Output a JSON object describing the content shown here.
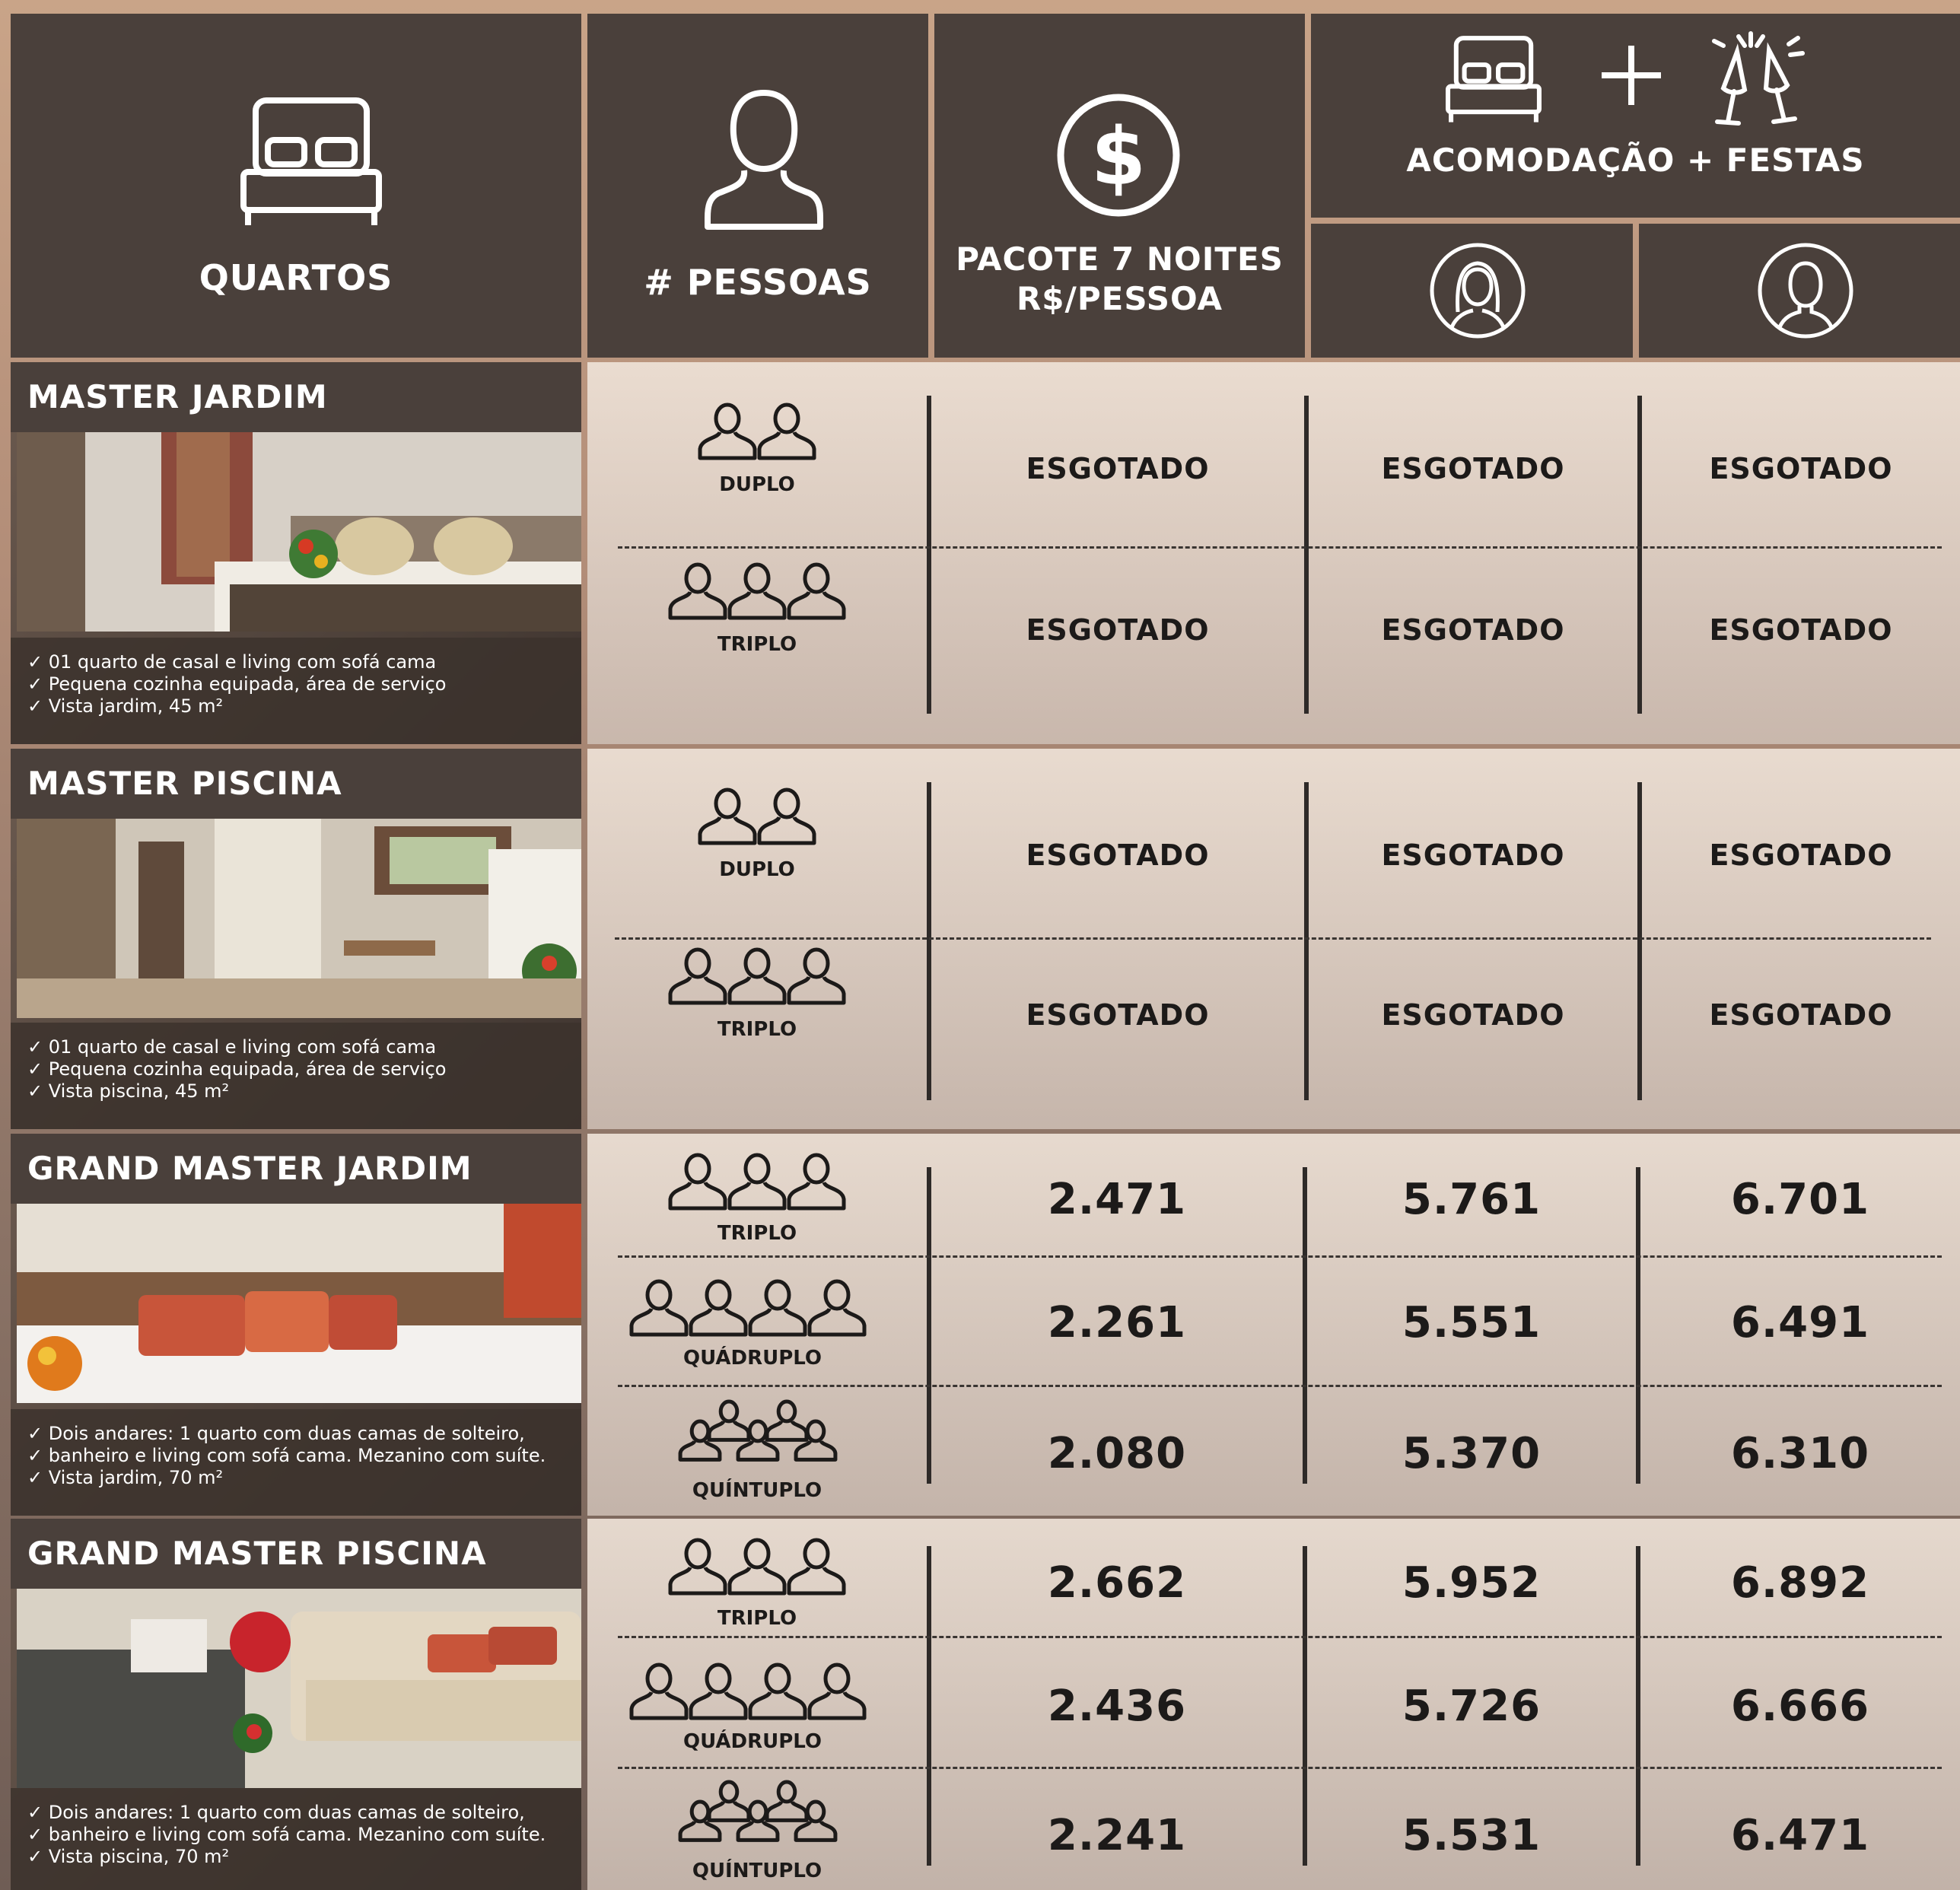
{
  "header": {
    "quartos": "QUARTOS",
    "pessoas": "# PESSOAS",
    "pacote_line1": "PACOTE 7 NOITES",
    "pacote_line2": "R$/PESSOA",
    "acomodacao": "ACOMODAÇÃO + FESTAS",
    "icons": {
      "quartos": "bed-icon",
      "pessoas": "person-icon",
      "pacote": "dollar-icon",
      "acomodacao": [
        "bed-icon",
        "plus-icon",
        "champagne-icon"
      ],
      "female": "female-avatar-icon",
      "male": "male-avatar-icon"
    }
  },
  "rooms": [
    {
      "name": "MASTER JARDIM",
      "features": [
        "01 quarto de casal e living com sofá cama",
        "Pequena cozinha equipada, área de serviço",
        "Vista jardim, 45 m²"
      ],
      "rows": [
        {
          "occupancy": "DUPLO",
          "people": 2,
          "pacote": "ESGOTADO",
          "female": "ESGOTADO",
          "male": "ESGOTADO"
        },
        {
          "occupancy": "TRIPLO",
          "people": 3,
          "pacote": "ESGOTADO",
          "female": "ESGOTADO",
          "male": "ESGOTADO"
        }
      ]
    },
    {
      "name": "MASTER PISCINA",
      "features": [
        "01 quarto de casal e living com sofá cama",
        "Pequena cozinha equipada, área de serviço",
        "Vista piscina, 45 m²"
      ],
      "rows": [
        {
          "occupancy": "DUPLO",
          "people": 2,
          "pacote": "ESGOTADO",
          "female": "ESGOTADO",
          "male": "ESGOTADO"
        },
        {
          "occupancy": "TRIPLO",
          "people": 3,
          "pacote": "ESGOTADO",
          "female": "ESGOTADO",
          "male": "ESGOTADO"
        }
      ]
    },
    {
      "name": "GRAND MASTER JARDIM",
      "features": [
        "Dois andares: 1 quarto com duas camas de solteiro,",
        "banheiro e living com sofá cama. Mezanino com suíte.",
        "Vista jardim, 70 m²"
      ],
      "rows": [
        {
          "occupancy": "TRIPLO",
          "people": 3,
          "pacote": "2.471",
          "female": "5.761",
          "male": "6.701"
        },
        {
          "occupancy": "QUÁDRUPLO",
          "people": 4,
          "pacote": "2.261",
          "female": "5.551",
          "male": "6.491"
        },
        {
          "occupancy": "QUÍNTUPLO",
          "people": 5,
          "pacote": "2.080",
          "female": "5.370",
          "male": "6.310"
        }
      ]
    },
    {
      "name": "GRAND MASTER PISCINA",
      "features": [
        "Dois andares: 1 quarto com duas camas de solteiro,",
        "banheiro e living com sofá cama. Mezanino com suíte.",
        "Vista piscina, 70 m²"
      ],
      "rows": [
        {
          "occupancy": "TRIPLO",
          "people": 3,
          "pacote": "2.662",
          "female": "5.952",
          "male": "6.892"
        },
        {
          "occupancy": "QUÁDRUPLO",
          "people": 4,
          "pacote": "2.436",
          "female": "5.726",
          "male": "6.666"
        },
        {
          "occupancy": "QUÍNTUPLO",
          "people": 5,
          "pacote": "2.241",
          "female": "5.531",
          "male": "6.471"
        }
      ]
    }
  ]
}
